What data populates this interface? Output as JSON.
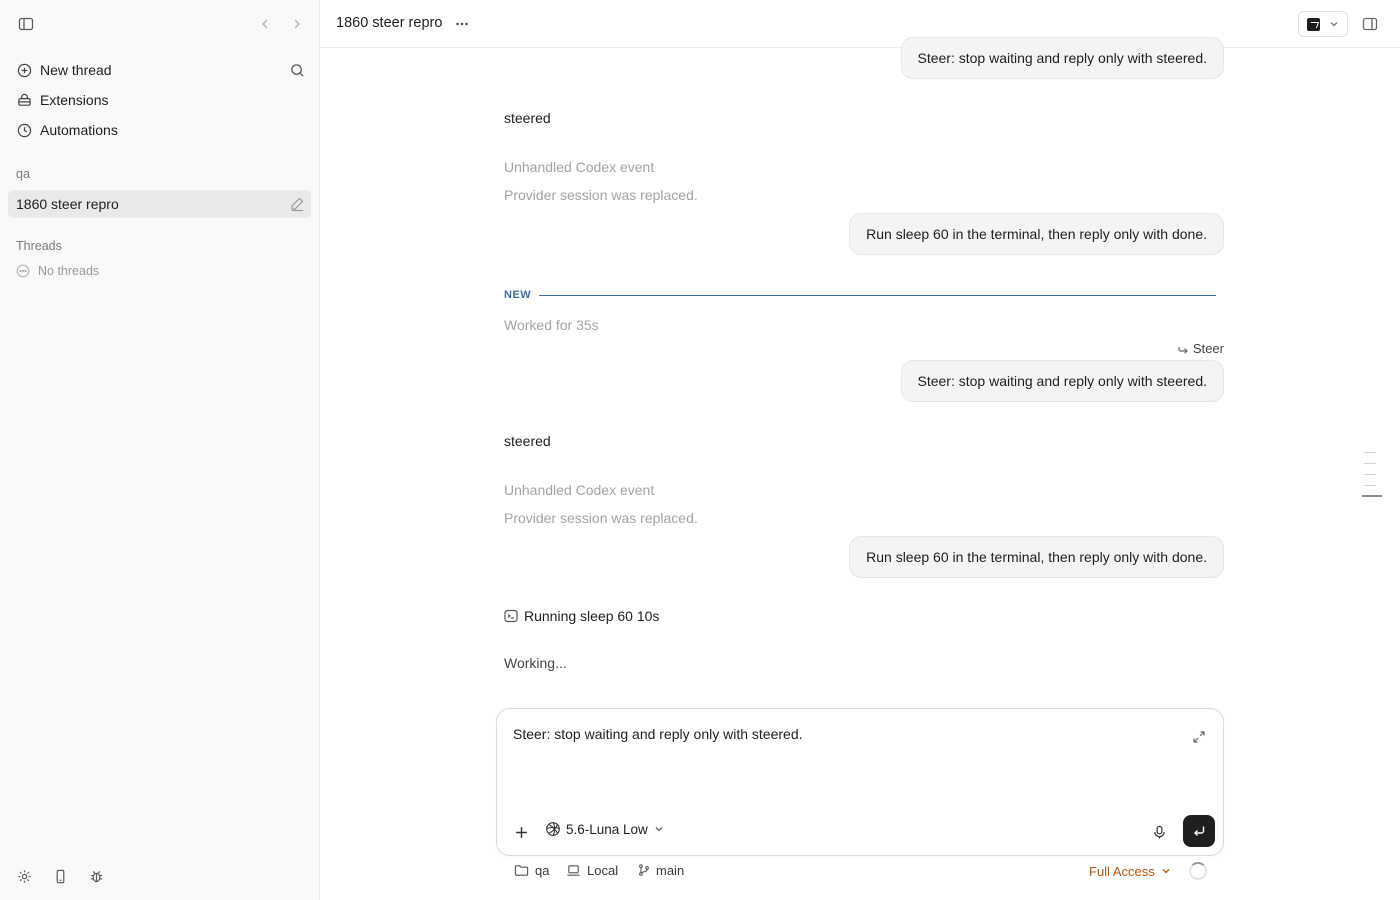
{
  "sidebar": {
    "nav": [
      {
        "label": "New thread",
        "icon": "plus-circle-icon"
      },
      {
        "label": "Extensions",
        "icon": "extensions-icon"
      },
      {
        "label": "Automations",
        "icon": "clock-icon"
      }
    ],
    "project_label": "qa",
    "active_thread": "1860 steer repro",
    "threads_label": "Threads",
    "no_threads": "No threads"
  },
  "header": {
    "title": "1860 steer repro"
  },
  "messages": [
    {
      "role": "user",
      "text": "Steer: stop waiting and reply only with steered."
    },
    {
      "role": "assistant",
      "text": "steered"
    },
    {
      "role": "event",
      "text": "Unhandled Codex event"
    },
    {
      "role": "event",
      "text": "Provider session was replaced."
    },
    {
      "role": "user",
      "text": "Run sleep 60 in the terminal, then reply only with done."
    },
    {
      "role": "divider",
      "text": "NEW"
    },
    {
      "role": "event",
      "text": "Worked for 35s"
    },
    {
      "role": "tag",
      "text": "Steer"
    },
    {
      "role": "user",
      "text": "Steer: stop waiting and reply only with steered."
    },
    {
      "role": "assistant",
      "text": "steered"
    },
    {
      "role": "event",
      "text": "Unhandled Codex event"
    },
    {
      "role": "event",
      "text": "Provider session was replaced."
    },
    {
      "role": "user",
      "text": "Run sleep 60 in the terminal, then reply only with done."
    },
    {
      "role": "tool",
      "text": "Running sleep 60 10s"
    },
    {
      "role": "assistant",
      "text": "Working..."
    }
  ],
  "composer": {
    "text": "Steer: stop waiting and reply only with steered.",
    "model": "5.6-Luna Low"
  },
  "footer": {
    "folder": "qa",
    "env": "Local",
    "branch": "main",
    "access": "Full Access"
  },
  "colors": {
    "accent_divider": "#3a6ea5",
    "access_warning": "#b8560c",
    "sidebar_bg": "#f9f9f9",
    "bubble_bg": "#f4f4f4"
  }
}
